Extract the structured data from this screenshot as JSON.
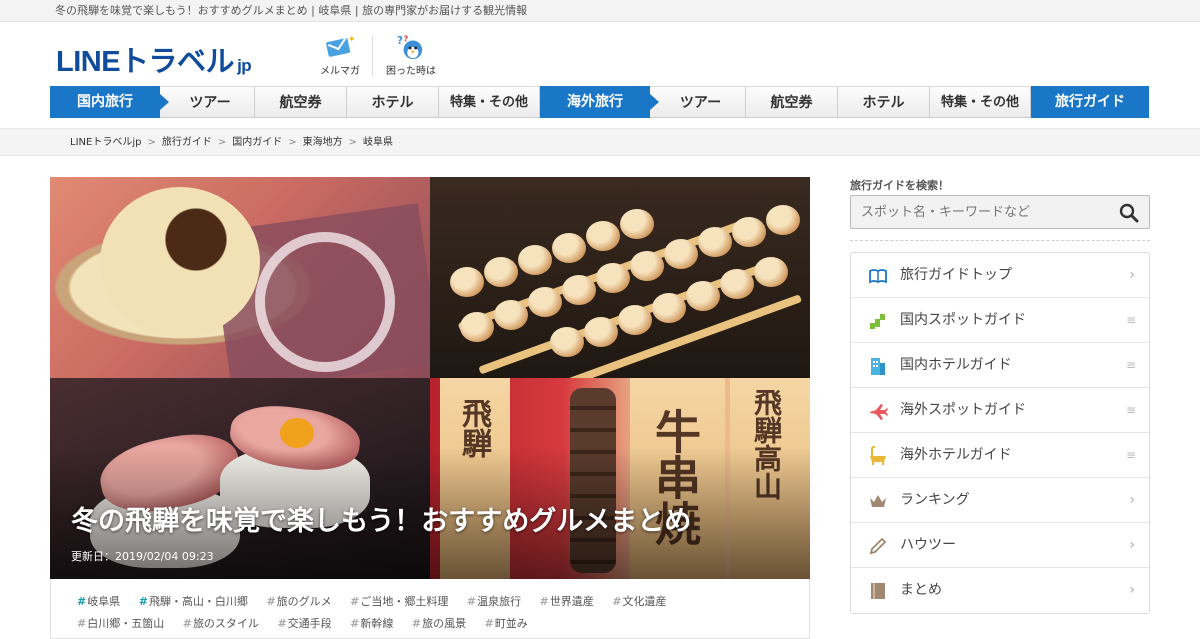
{
  "top_strip": "冬の飛騨を味覚で楽しもう！おすすめグルメまとめ | 岐阜県 | 旅の専門家がお届けする観光情報",
  "logo": {
    "main": "LINEトラベル",
    "suffix": "jp"
  },
  "header_icons": [
    {
      "label": "メルマガ",
      "icon": "mail-magazine-icon"
    },
    {
      "label": "困った時は",
      "icon": "help-bird-icon"
    }
  ],
  "nav": {
    "domestic": {
      "label": "国内旅行",
      "items": [
        "ツアー",
        "航空券",
        "ホテル",
        "特集・その他"
      ]
    },
    "overseas": {
      "label": "海外旅行",
      "items": [
        "ツアー",
        "航空券",
        "ホテル",
        "特集・その他"
      ]
    },
    "guide": "旅行ガイド"
  },
  "breadcrumb": [
    "LINEトラベルjp",
    "旅行ガイド",
    "国内ガイド",
    "東海地方",
    "岐阜県"
  ],
  "hero": {
    "title": "冬の飛騨を味覚で楽しもう！おすすめグルメまとめ",
    "updated": "更新日：2019/02/04 09:23"
  },
  "tags_row1": [
    {
      "label": "岐阜県",
      "highlight": true
    },
    {
      "label": "飛騨・高山・白川郷",
      "highlight": true
    },
    {
      "label": "旅のグルメ",
      "highlight": false
    },
    {
      "label": "ご当地・郷土料理",
      "highlight": false
    },
    {
      "label": "温泉旅行",
      "highlight": false
    },
    {
      "label": "世界遺産",
      "highlight": false
    },
    {
      "label": "文化遺産",
      "highlight": false
    }
  ],
  "tags_row2": [
    {
      "label": "白川郷・五箇山",
      "highlight": false
    },
    {
      "label": "旅のスタイル",
      "highlight": false
    },
    {
      "label": "交通手段",
      "highlight": false
    },
    {
      "label": "新幹線",
      "highlight": false
    },
    {
      "label": "旅の風景",
      "highlight": false
    },
    {
      "label": "町並み",
      "highlight": false
    }
  ],
  "sidebar": {
    "search_label": "旅行ガイドを検索！",
    "search_placeholder": "スポット名・キーワードなど",
    "menu": [
      {
        "label": "旅行ガイドトップ",
        "icon": "book-icon",
        "indicator": "chevron"
      },
      {
        "label": "国内スポットガイド",
        "icon": "japan-map-icon",
        "indicator": "lines"
      },
      {
        "label": "国内ホテルガイド",
        "icon": "building-icon",
        "indicator": "lines"
      },
      {
        "label": "海外スポットガイド",
        "icon": "airplane-icon",
        "indicator": "lines"
      },
      {
        "label": "海外ホテルガイド",
        "icon": "bathtub-icon",
        "indicator": "lines"
      },
      {
        "label": "ランキング",
        "icon": "crown-icon",
        "indicator": "chevron"
      },
      {
        "label": "ハウツー",
        "icon": "pencil-icon",
        "indicator": "chevron"
      },
      {
        "label": "まとめ",
        "icon": "bookmark-book-icon",
        "indicator": "chevron"
      }
    ]
  },
  "colors": {
    "brand": "#0f4c9c",
    "nav_blue": "#1a76c7",
    "tag_highlight": "#1a9cb0"
  }
}
